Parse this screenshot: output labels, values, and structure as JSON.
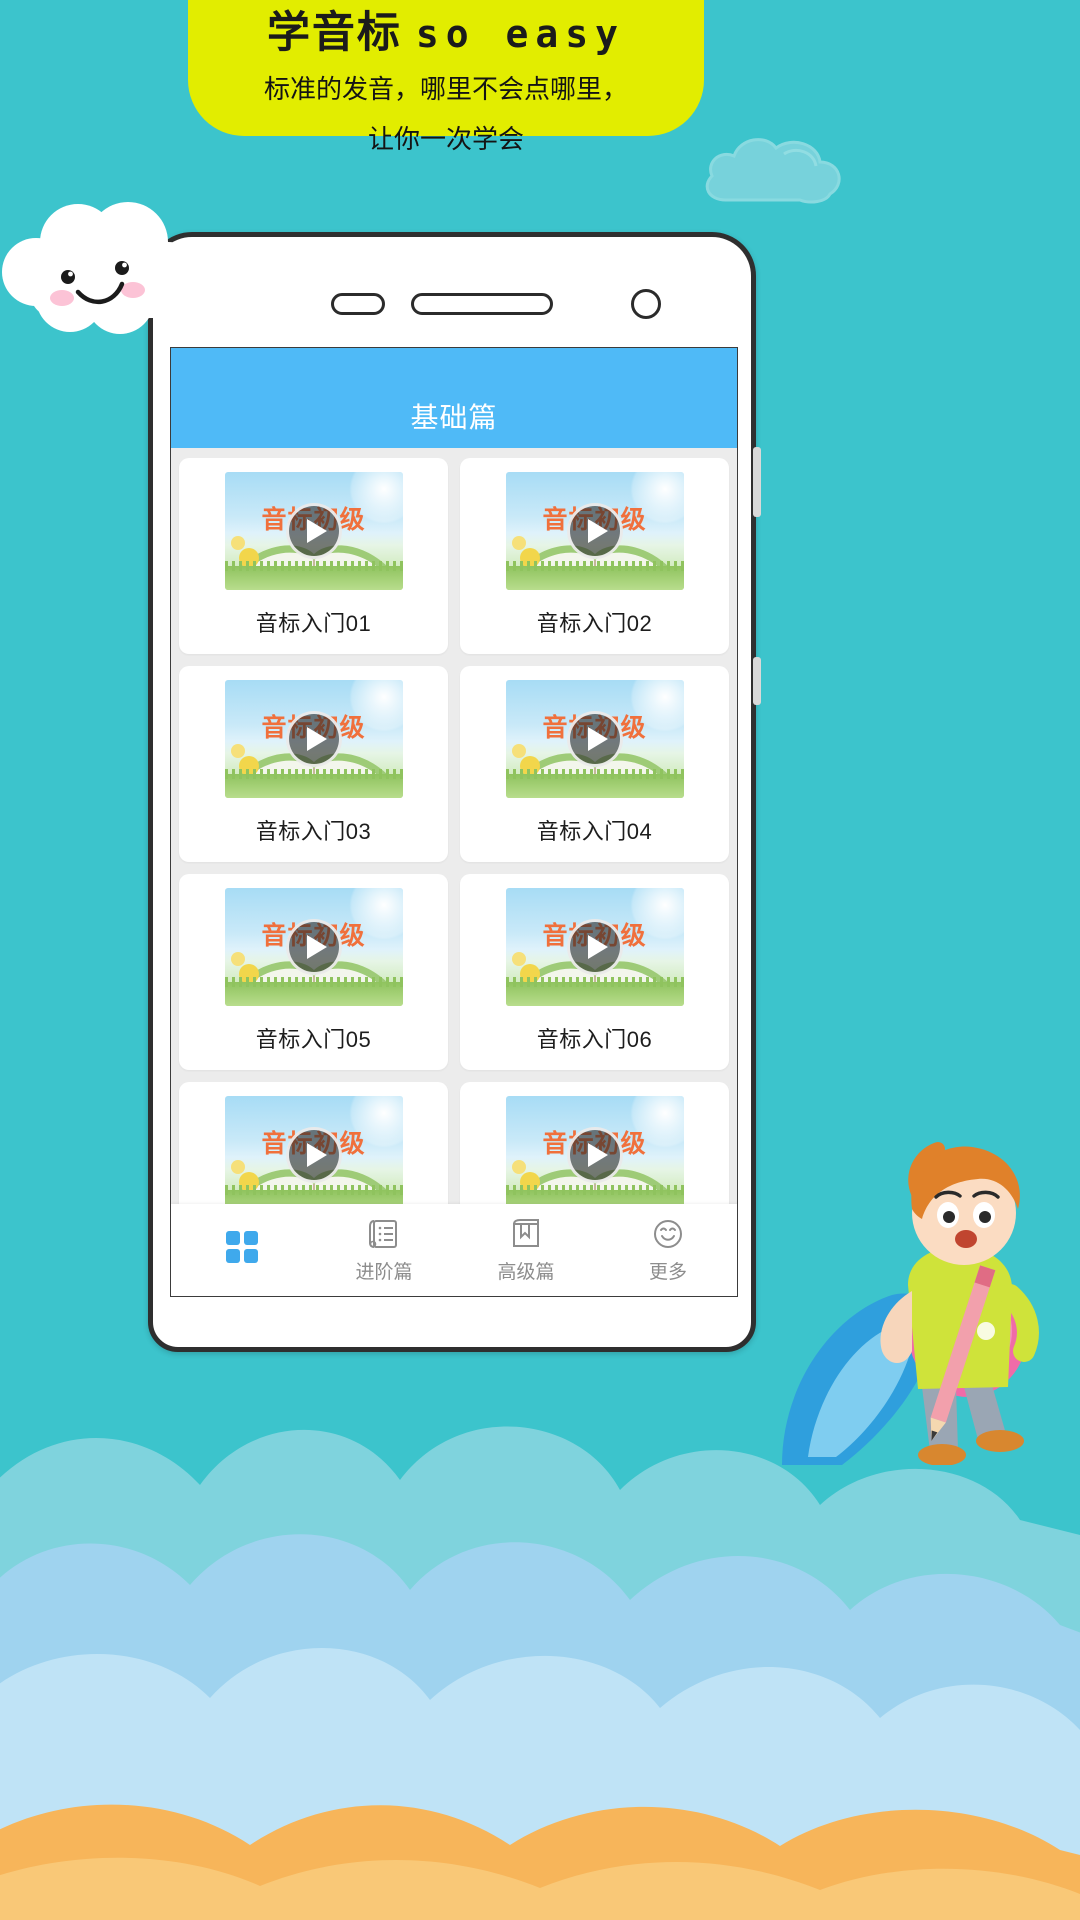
{
  "background": {
    "teal": "#3cc4cc",
    "banner_yellow": "#e2ed00",
    "cloud_white": "#ffffff",
    "sky_blue": "#9fd3ef",
    "sand_orange": "#f7b55a"
  },
  "banner": {
    "title_cn": "学音标",
    "title_en": "so easy",
    "subtitle_line1": "标准的发音，哪里不会点哪里，",
    "subtitle_line2": "让你一次学会"
  },
  "phone": {
    "speaker_small": "earpiece-small",
    "speaker_long": "earpiece-long",
    "camera": "front-camera"
  },
  "app": {
    "header": {
      "title": "基础篇",
      "bg": "#4fbaf7"
    },
    "thumb_overlay_text": "音标初级",
    "cards": [
      {
        "label": "音标入门01"
      },
      {
        "label": "音标入门02"
      },
      {
        "label": "音标入门03"
      },
      {
        "label": "音标入门04"
      },
      {
        "label": "音标入门05"
      },
      {
        "label": "音标入门06"
      },
      {
        "label": ""
      },
      {
        "label": ""
      }
    ],
    "tabbar": [
      {
        "label": "",
        "icon": "grid-icon",
        "active": true
      },
      {
        "label": "进阶篇",
        "icon": "list-document-icon",
        "active": false
      },
      {
        "label": "高级篇",
        "icon": "book-icon",
        "active": false
      },
      {
        "label": "更多",
        "icon": "smiley-face-icon",
        "active": false
      }
    ]
  },
  "decorations": {
    "cloud_mascot": "smiling-cloud-icon",
    "cloud_outline": "cloud-outline-icon",
    "student_mascot": "student-with-pencil-icon"
  }
}
